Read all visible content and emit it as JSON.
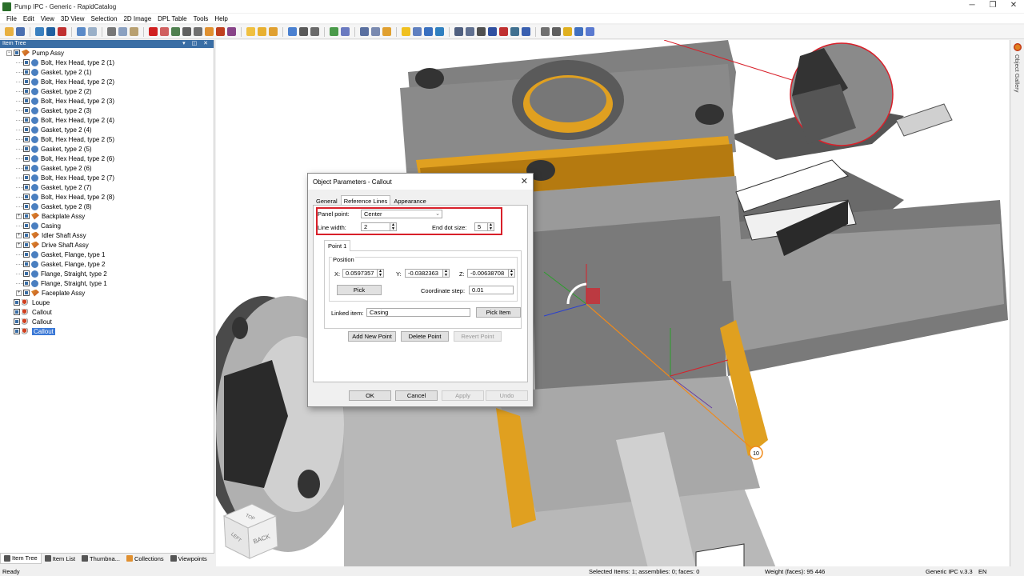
{
  "window": {
    "title": "Pump IPC - Generic - RapidCatalog",
    "controls": [
      "─",
      "❐",
      "✕"
    ]
  },
  "menu": [
    "File",
    "Edit",
    "View",
    "3D View",
    "Selection",
    "2D Image",
    "DPL Table",
    "Tools",
    "Help"
  ],
  "left_panel": {
    "header": "Item Tree",
    "header_controls": "▾ ◫ ✕",
    "tree": [
      {
        "label": "Pump Assy",
        "level": 0,
        "icon": "assembly-icon",
        "expander": "−"
      },
      {
        "label": "Bolt, Hex Head, type 2 (1)",
        "level": 1,
        "icon": "part-icon"
      },
      {
        "label": "Gasket, type 2 (1)",
        "level": 1,
        "icon": "part-icon"
      },
      {
        "label": "Bolt, Hex Head, type 2 (2)",
        "level": 1,
        "icon": "part-icon"
      },
      {
        "label": "Gasket, type 2 (2)",
        "level": 1,
        "icon": "part-icon"
      },
      {
        "label": "Bolt, Hex Head, type 2 (3)",
        "level": 1,
        "icon": "part-icon"
      },
      {
        "label": "Gasket, type 2 (3)",
        "level": 1,
        "icon": "part-icon"
      },
      {
        "label": "Bolt, Hex Head, type 2 (4)",
        "level": 1,
        "icon": "part-icon"
      },
      {
        "label": "Gasket, type 2 (4)",
        "level": 1,
        "icon": "part-icon"
      },
      {
        "label": "Bolt, Hex Head, type 2 (5)",
        "level": 1,
        "icon": "part-icon"
      },
      {
        "label": "Gasket, type 2 (5)",
        "level": 1,
        "icon": "part-icon"
      },
      {
        "label": "Bolt, Hex Head, type 2 (6)",
        "level": 1,
        "icon": "part-icon"
      },
      {
        "label": "Gasket, type 2 (6)",
        "level": 1,
        "icon": "part-icon"
      },
      {
        "label": "Bolt, Hex Head, type 2 (7)",
        "level": 1,
        "icon": "part-icon"
      },
      {
        "label": "Gasket, type 2 (7)",
        "level": 1,
        "icon": "part-icon"
      },
      {
        "label": "Bolt, Hex Head, type 2 (8)",
        "level": 1,
        "icon": "part-icon"
      },
      {
        "label": "Gasket, type 2 (8)",
        "level": 1,
        "icon": "part-icon"
      },
      {
        "label": "Backplate Assy",
        "level": 1,
        "icon": "assembly-icon",
        "expander": "+"
      },
      {
        "label": "Casing",
        "level": 1,
        "icon": "part-icon"
      },
      {
        "label": "Idler Shaft Assy",
        "level": 1,
        "icon": "assembly-icon",
        "expander": "+"
      },
      {
        "label": "Drive Shaft Assy",
        "level": 1,
        "icon": "assembly-icon",
        "expander": "+"
      },
      {
        "label": "Gasket, Flange, type 1",
        "level": 1,
        "icon": "part-icon"
      },
      {
        "label": "Gasket, Flange, type 2",
        "level": 1,
        "icon": "part-icon"
      },
      {
        "label": "Flange, Straight, type 2",
        "level": 1,
        "icon": "part-icon"
      },
      {
        "label": "Flange, Straight, type 1",
        "level": 1,
        "icon": "part-icon"
      },
      {
        "label": "Faceplate Assy",
        "level": 1,
        "icon": "assembly-icon",
        "expander": "+"
      },
      {
        "label": "Loupe",
        "level": 0,
        "icon": "annotation-icon"
      },
      {
        "label": "Callout",
        "level": 0,
        "icon": "annotation-icon"
      },
      {
        "label": "Callout",
        "level": 0,
        "icon": "annotation-icon"
      },
      {
        "label": "Callout",
        "level": 0,
        "icon": "annotation-icon",
        "selected": true
      }
    ],
    "bottom_tabs": [
      "Item Tree",
      "Item List",
      "Thumbna...",
      "Collections",
      "Viewpoints"
    ]
  },
  "right_sidebar": {
    "label": "Object Gallery"
  },
  "viewport": {
    "callout_number": "10",
    "view_cube": {
      "top": "TOP",
      "left": "LEFT",
      "back": "BACK"
    },
    "colors": {
      "accent_orange": "#f0a020",
      "callout_line": "#f08a1a",
      "loupe_line": "#d8202a"
    }
  },
  "dialog": {
    "title": "Object Parameters - Callout",
    "tabs": [
      "General",
      "Reference Lines",
      "Appearance"
    ],
    "active_tab": "Reference Lines",
    "panel_point_label": "Panel point:",
    "panel_point_value": "Center",
    "line_width_label": "Line width:",
    "line_width_value": "2",
    "end_dot_label": "End dot size:",
    "end_dot_value": "5",
    "point_tab": "Point 1",
    "position_label": "Position",
    "x_label": "X:",
    "x_value": "0.0597357",
    "y_label": "Y:",
    "y_value": "-0.0382363",
    "z_label": "Z:",
    "z_value": "-0.00638708",
    "pick_label": "Pick",
    "coord_step_label": "Coordinate step:",
    "coord_step_value": "0.01",
    "linked_item_label": "Linked item:",
    "linked_item_value": "Casing",
    "pick_item_label": "Pick Item",
    "add_point_label": "Add New Point",
    "delete_point_label": "Delete Point",
    "revert_point_label": "Revert Point",
    "ok_label": "OK",
    "cancel_label": "Cancel",
    "apply_label": "Apply",
    "undo_label": "Undo",
    "highlight_color": "#d8202a"
  },
  "status": {
    "left": "Ready",
    "selected": "Selected Items: 1; assemblies: 0; faces: 0",
    "weight": "Weight (faces): 95 446",
    "product": "Generic IPC v.3.3",
    "lang": "EN"
  }
}
